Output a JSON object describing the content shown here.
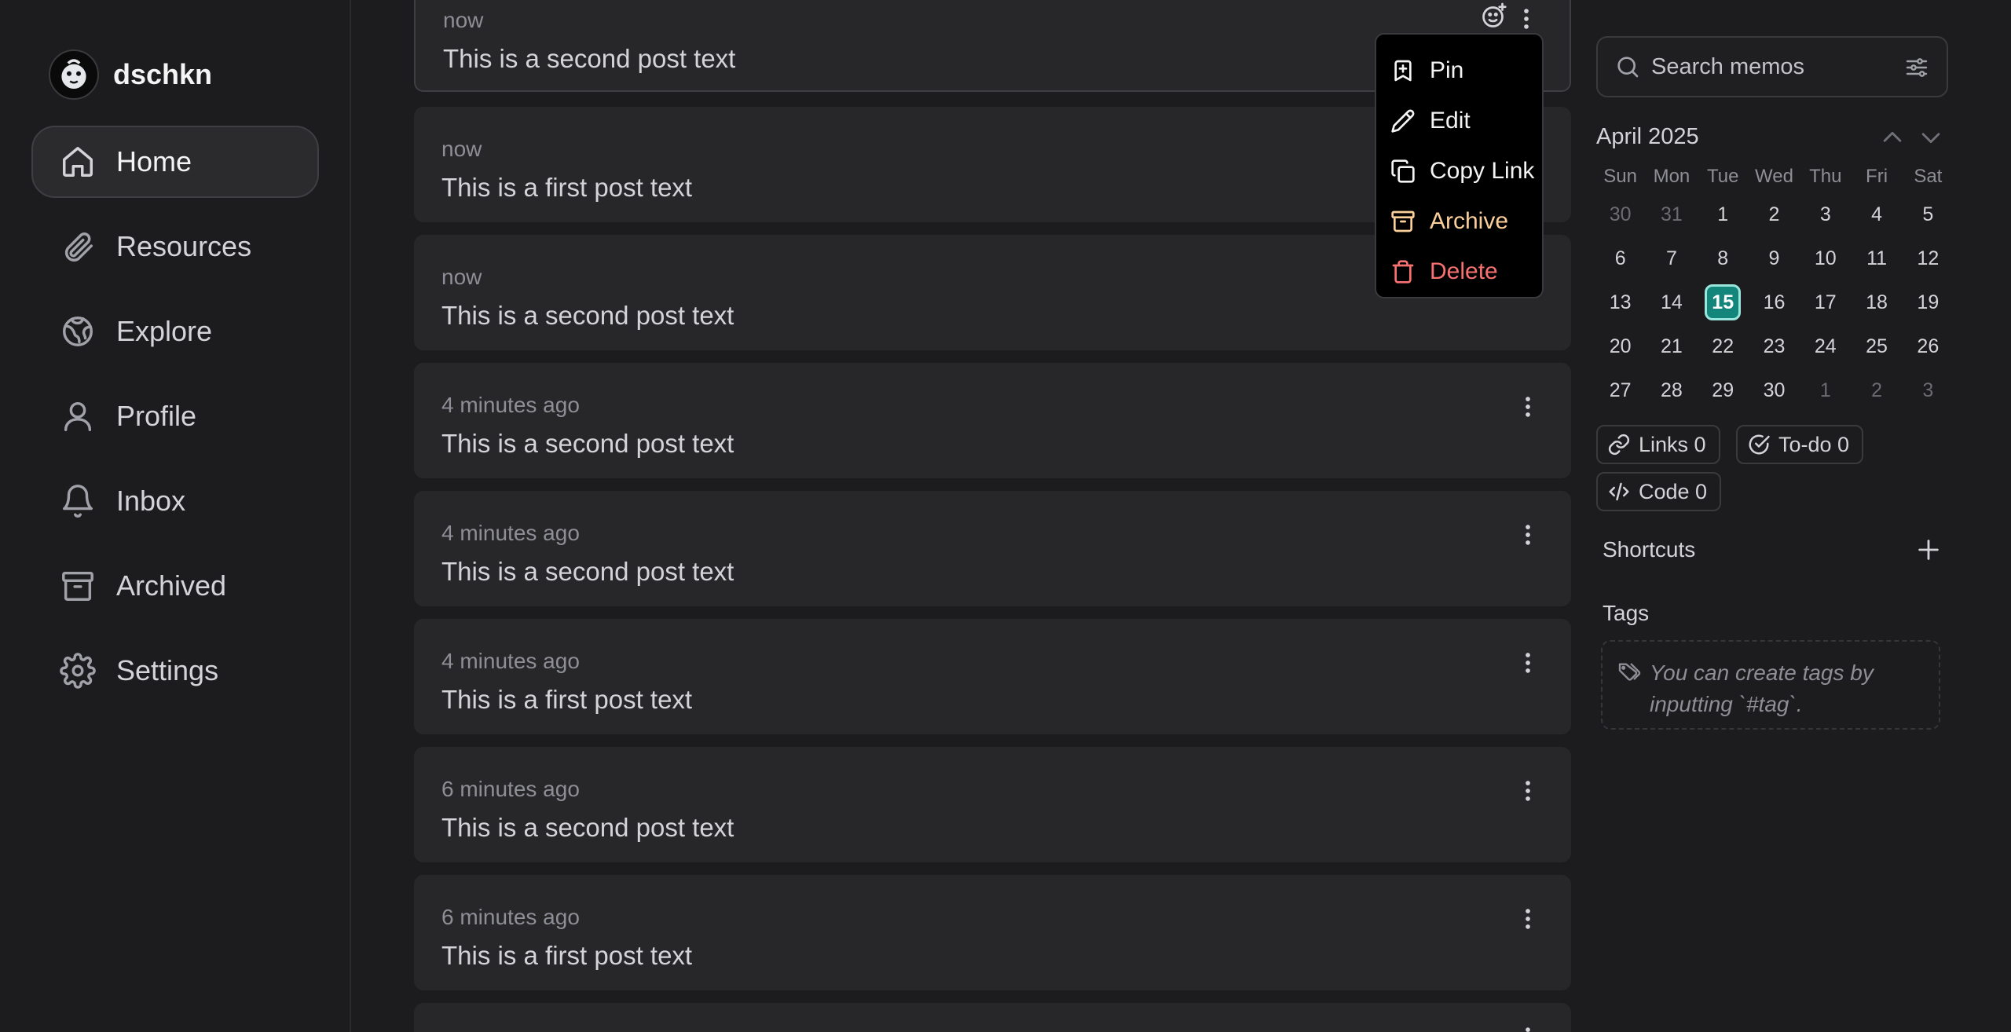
{
  "sidebar": {
    "username": "dschkn",
    "nav": [
      {
        "label": "Home",
        "icon": "home-icon",
        "active": true
      },
      {
        "label": "Resources",
        "icon": "paperclip-icon"
      },
      {
        "label": "Explore",
        "icon": "globe-icon"
      },
      {
        "label": "Profile",
        "icon": "user-icon"
      },
      {
        "label": "Inbox",
        "icon": "bell-icon"
      },
      {
        "label": "Archived",
        "icon": "archive-icon"
      },
      {
        "label": "Settings",
        "icon": "gear-icon"
      }
    ]
  },
  "memos": [
    {
      "time": "now",
      "text": "This is a second post text"
    },
    {
      "time": "now",
      "text": "This is a first post text"
    },
    {
      "time": "now",
      "text": "This is a second post text"
    },
    {
      "time": "4 minutes ago",
      "text": "This is a second post text"
    },
    {
      "time": "4 minutes ago",
      "text": "This is a second post text"
    },
    {
      "time": "4 minutes ago",
      "text": "This is a first post text"
    },
    {
      "time": "6 minutes ago",
      "text": "This is a second post text"
    },
    {
      "time": "6 minutes ago",
      "text": "This is a first post text"
    }
  ],
  "menu": {
    "pin": "Pin",
    "edit": "Edit",
    "copy_link": "Copy Link",
    "archive": "Archive",
    "delete": "Delete"
  },
  "search": {
    "placeholder": "Search memos"
  },
  "calendar": {
    "title": "April 2025",
    "weekdays": [
      "Sun",
      "Mon",
      "Tue",
      "Wed",
      "Thu",
      "Fri",
      "Sat"
    ],
    "weeks": [
      [
        "30",
        "31",
        "1",
        "2",
        "3",
        "4",
        "5"
      ],
      [
        "6",
        "7",
        "8",
        "9",
        "10",
        "11",
        "12"
      ],
      [
        "13",
        "14",
        "15",
        "16",
        "17",
        "18",
        "19"
      ],
      [
        "20",
        "21",
        "22",
        "23",
        "24",
        "25",
        "26"
      ],
      [
        "27",
        "28",
        "29",
        "30",
        "1",
        "2",
        "3"
      ]
    ],
    "today": "15"
  },
  "stats": {
    "links": "Links 0",
    "todo": "To-do 0",
    "code": "Code 0"
  },
  "shortcuts": {
    "title": "Shortcuts"
  },
  "tags": {
    "title": "Tags",
    "empty": "You can create tags by inputting `#tag`."
  },
  "colors": {
    "background": "#1c1c1e",
    "card": "#27272a",
    "accent": "#14857a",
    "archive": "#fbcf9a",
    "delete": "#f87171"
  }
}
